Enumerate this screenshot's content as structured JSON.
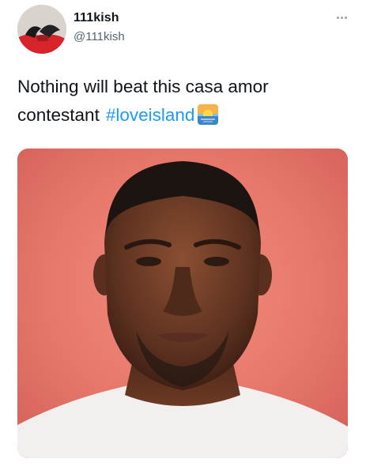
{
  "tweet": {
    "display_name": "111kish",
    "handle": "@111kish",
    "text_main": "Nothing will beat this casa amor contestant",
    "hashtag": "#loveisland",
    "emoji_icon": "sunset-island-emoji-icon",
    "more_icon": "more-options-icon"
  },
  "colors": {
    "text": "#0f1419",
    "handle": "#536471",
    "hashtag": "#1d9bf0",
    "photo_background": "#e9796a"
  }
}
